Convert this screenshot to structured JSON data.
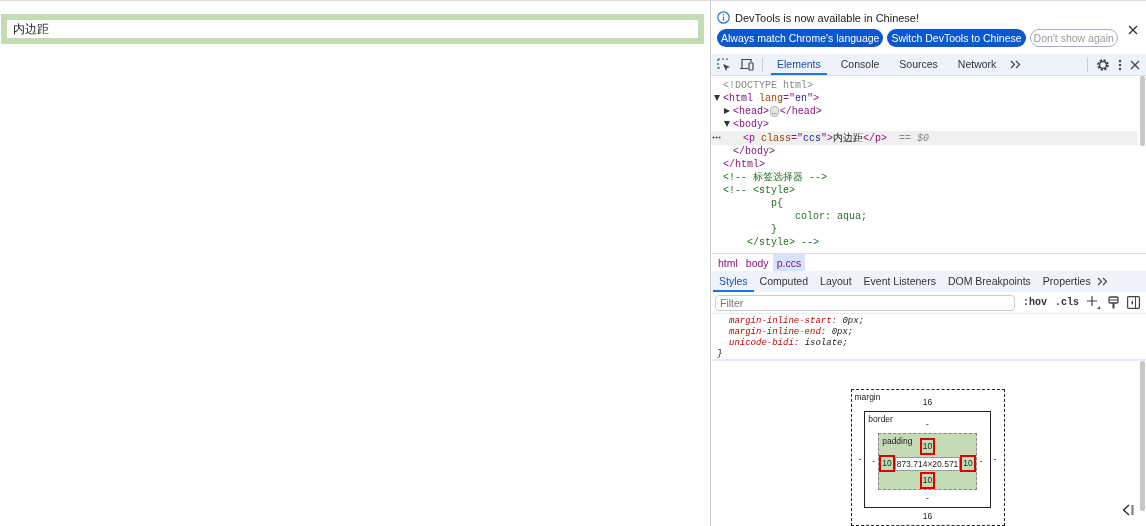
{
  "page": {
    "paragraph": "内边距"
  },
  "infobar": {
    "message": "DevTools is now available in Chinese!",
    "buttons": [
      {
        "label": "Always match Chrome's language",
        "kind": "primary"
      },
      {
        "label": "Switch DevTools to Chinese",
        "kind": "primary"
      },
      {
        "label": "Don't show again",
        "kind": "outline"
      }
    ]
  },
  "main_tabs": [
    {
      "label": "Elements",
      "selected": true
    },
    {
      "label": "Console",
      "selected": false
    },
    {
      "label": "Sources",
      "selected": false
    },
    {
      "label": "Network",
      "selected": false
    }
  ],
  "dom_tree": [
    {
      "kind": "doctype",
      "selected": false,
      "text": "<!DOCTYPE html>"
    },
    {
      "kind": "element",
      "expanded": true,
      "selected": false,
      "open": [
        {
          "t": "<html",
          "kind": "tag"
        },
        {
          "t": " lang",
          "kind": "attr"
        },
        {
          "t": "=\"",
          "kind": "tag"
        },
        {
          "t": "en",
          "kind": "value"
        },
        {
          "t": "\">",
          "kind": "tag"
        }
      ],
      "close": [
        {
          "t": "</html>",
          "kind": "tag"
        }
      ],
      "children": [
        {
          "kind": "element",
          "expanded": false,
          "selected": false,
          "open": [
            {
              "t": "<head>",
              "kind": "tag"
            },
            {
              "t": "…",
              "kind": "badge"
            },
            {
              "t": "</head>",
              "kind": "tag"
            }
          ]
        },
        {
          "kind": "element",
          "expanded": true,
          "selected": false,
          "open": [
            {
              "t": "<body>",
              "kind": "tag"
            }
          ],
          "close": [
            {
              "t": "</body>",
              "kind": "tag"
            }
          ],
          "children": [
            {
              "kind": "element",
              "selected": true,
              "open": [
                {
                  "t": "<p",
                  "kind": "tag"
                },
                {
                  "t": " class",
                  "kind": "attr"
                },
                {
                  "t": "=\"",
                  "kind": "tag"
                },
                {
                  "t": "ccs",
                  "kind": "value"
                },
                {
                  "t": "\">",
                  "kind": "tag"
                },
                {
                  "t": "内边距",
                  "kind": "text"
                },
                {
                  "t": "</p>",
                  "kind": "tag"
                }
              ],
              "marker": "== $0"
            }
          ]
        }
      ]
    },
    {
      "kind": "comment",
      "selected": false,
      "lines": [
        "<!-- 标签选择器 -->"
      ]
    },
    {
      "kind": "comment",
      "selected": false,
      "lines": [
        "<!-- <style>",
        "        p{",
        "            color: aqua;",
        "        }",
        "    </style> -->"
      ]
    }
  ],
  "breadcrumbs": [
    {
      "label": "html",
      "selected": false
    },
    {
      "label": "body",
      "selected": false
    },
    {
      "label": "p.ccs",
      "selected": true
    }
  ],
  "side_tabs": [
    {
      "label": "Styles",
      "selected": true
    },
    {
      "label": "Computed",
      "selected": false
    },
    {
      "label": "Layout",
      "selected": false
    },
    {
      "label": "Event Listeners",
      "selected": false
    },
    {
      "label": "DOM Breakpoints",
      "selected": false
    },
    {
      "label": "Properties",
      "selected": false
    }
  ],
  "filter": {
    "placeholder": "Filter",
    "toggles": [
      ":hov",
      ".cls"
    ]
  },
  "css_declarations": [
    {
      "property": "margin-inline-start:",
      "value": "0px;"
    },
    {
      "property": "margin-inline-end:",
      "value": "0px;"
    },
    {
      "property": "unicode-bidi:",
      "value": "isolate;"
    }
  ],
  "css_close": "}",
  "box_model": {
    "margin": {
      "label": "margin",
      "top": {
        "text": "16",
        "highlighted": false
      },
      "right": {
        "text": "-",
        "highlighted": false
      },
      "bottom": {
        "text": "16",
        "highlighted": false
      },
      "left": {
        "text": "-",
        "highlighted": false
      }
    },
    "border": {
      "label": "border",
      "top": {
        "text": "-",
        "highlighted": false
      },
      "right": {
        "text": "-",
        "highlighted": false
      },
      "bottom": {
        "text": "-",
        "highlighted": false
      },
      "left": {
        "text": "-",
        "highlighted": false
      }
    },
    "padding": {
      "label": "padding",
      "top": {
        "text": "10",
        "highlighted": true
      },
      "right": {
        "text": "10",
        "highlighted": true
      },
      "bottom": {
        "text": "10",
        "highlighted": true
      },
      "left": {
        "text": "10",
        "highlighted": true
      }
    },
    "content": "873.714×20.571"
  }
}
